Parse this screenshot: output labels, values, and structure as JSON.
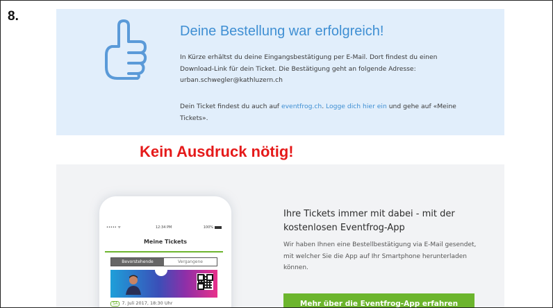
{
  "step_number": "8.",
  "success": {
    "title": "Deine Bestellung war erfolgreich!",
    "line1": "In Kürze erhältst du deine Eingangsbestätigung per E-Mail. Dort findest du einen Download-Link für dein Ticket. Die Bestätigung geht an folgende Adresse:",
    "email": "urban.schwegler@kathluzern.ch",
    "line2_before": "Dein Ticket findest du auch auf ",
    "site_link": "eventfrog.ch",
    "line2_sep": ". ",
    "login_link": "Logge dich hier ein",
    "line2_after": " und gehe auf «Meine Tickets».",
    "icon": "thumbs-up-icon",
    "accent_color": "#3f8fd3",
    "panel_color": "#e1eefb"
  },
  "annotation": {
    "text": "Kein Ausdruck nötig!",
    "color": "#e51a1a"
  },
  "phone": {
    "status_signal": "••••• ᯤ",
    "status_time": "12:34 PM",
    "status_battery": "100%",
    "title": "Meine Tickets",
    "tab_active": "Bevorstehende",
    "tab_inactive": "Vergangene",
    "ticket_day": "SA",
    "ticket_date": "7. Juli 2017, 18:30 Uhr"
  },
  "app": {
    "title": "Ihre Tickets immer mit dabei - mit der kostenlosen Eventfrog-App",
    "text": "Wir haben Ihnen eine Bestellbestätigung via E-Mail gesendet, mit welcher Sie die App auf Ihr Smartphone herunterladen können.",
    "button_label": "Mehr über die Eventfrog-App erfahren",
    "button_color": "#6cb52d"
  }
}
